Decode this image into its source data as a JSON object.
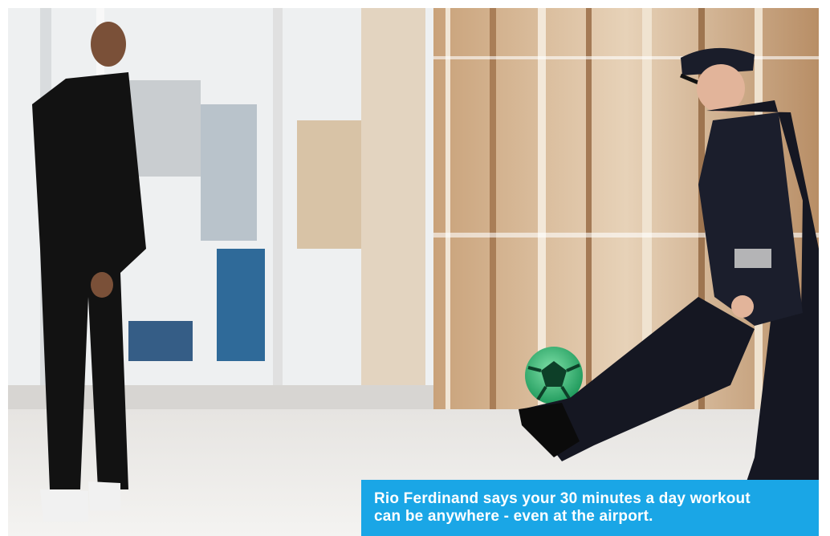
{
  "caption": {
    "line1": "Rio Ferdinand says your 30 minutes a day workout",
    "line2": "can be anywhere - even at the airport."
  },
  "colors": {
    "caption_background": "#1aa6e6",
    "caption_text": "#ffffff",
    "ball": "#2fb872"
  }
}
